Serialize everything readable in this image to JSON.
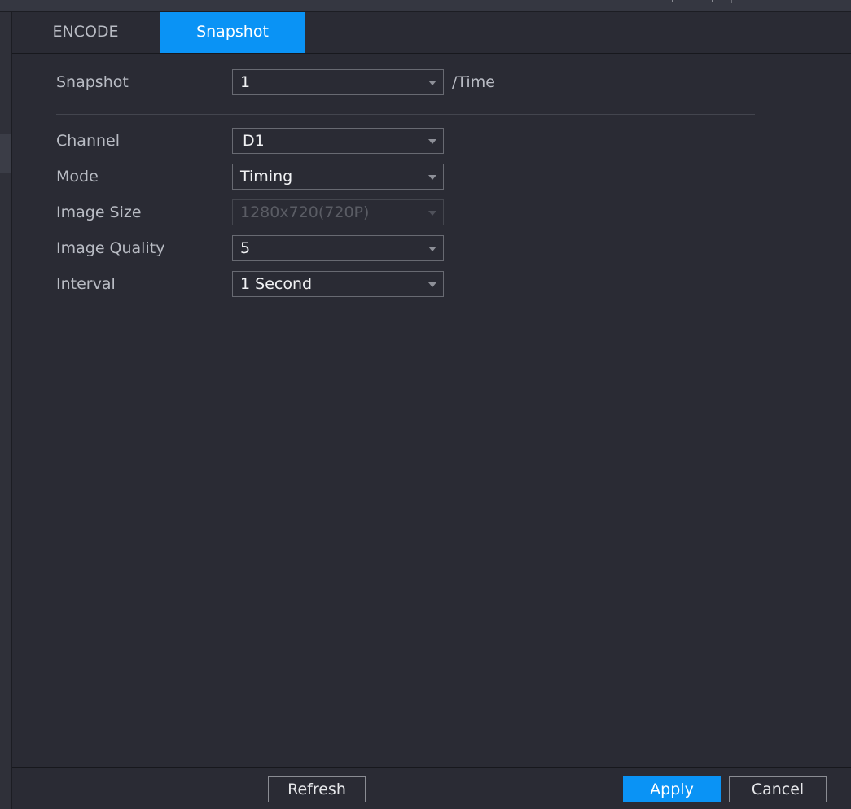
{
  "tabs": [
    {
      "label": "ENCODE",
      "active": false
    },
    {
      "label": "Snapshot",
      "active": true
    }
  ],
  "form": {
    "snapshot": {
      "label": "Snapshot",
      "value": "1",
      "suffix": "/Time"
    },
    "channel": {
      "label": "Channel",
      "value": "D1"
    },
    "mode": {
      "label": "Mode",
      "value": "Timing"
    },
    "image_size": {
      "label": "Image Size",
      "value": "1280x720(720P)",
      "disabled": true
    },
    "image_quality": {
      "label": "Image Quality",
      "value": "5"
    },
    "interval": {
      "label": "Interval",
      "value": "1 Second"
    }
  },
  "buttons": {
    "refresh": "Refresh",
    "apply": "Apply",
    "cancel": "Cancel"
  },
  "colors": {
    "accent": "#0a93f5",
    "background": "#2a2b34"
  }
}
